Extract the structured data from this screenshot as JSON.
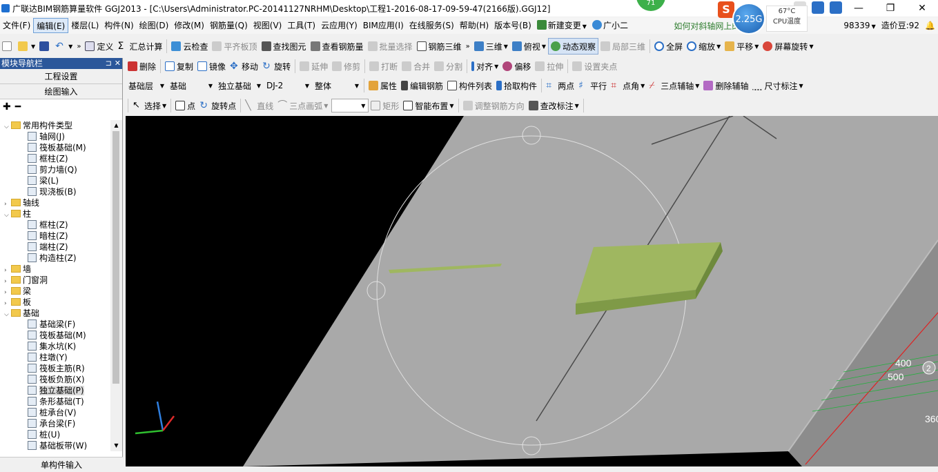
{
  "window": {
    "title": "广联达BIM钢筋算量软件 GGJ2013 - [C:\\Users\\Administrator.PC-20141127NRHM\\Desktop\\工程1-2016-08-17-09-59-47(2166版).GGJ12]",
    "minimize": "—",
    "maximize": "❐",
    "close": "✕"
  },
  "overlay": {
    "badge": "71",
    "memory": "2.25G",
    "cpu_temp": "67°C",
    "cpu_label": "CPU温度"
  },
  "menubar": {
    "items": [
      "文件(F)",
      "编辑(E)",
      "楼层(L)",
      "构件(N)",
      "绘图(D)",
      "修改(M)",
      "钢筋量(Q)",
      "视图(V)",
      "工具(T)",
      "云应用(Y)",
      "BIM应用(I)",
      "在线服务(S)",
      "帮助(H)",
      "版本号(B)"
    ],
    "new_change": "新建变更",
    "assistant": "广小二",
    "marquee": "如何对斜轴网上的",
    "account_id": "98339",
    "price_bean": "造价豆:92"
  },
  "toolbar1": {
    "define": "定义",
    "summary": "汇总计算",
    "cloud_check": "云检查",
    "flat_top": "平齐板顶",
    "find_element": "查找图元",
    "view_rebar": "查看钢筋量",
    "batch_select": "批量选择",
    "rebar_3d": "钢筋三维",
    "three_d": "三维",
    "top_view": "俯视",
    "dynamic_view": "动态观察",
    "local_3d": "局部三维",
    "fullscreen": "全屏",
    "zoom": "缩放",
    "pan": "平移",
    "screen_rotate": "屏幕旋转"
  },
  "toolbar2": {
    "delete": "删除",
    "copy": "复制",
    "mirror": "镜像",
    "move": "移动",
    "rotate": "旋转",
    "extend": "延伸",
    "trim": "修剪",
    "break": "打断",
    "merge": "合并",
    "split": "分割",
    "align": "对齐",
    "offset": "偏移",
    "stretch": "拉伸",
    "set_grip": "设置夹点"
  },
  "toolbar3": {
    "floor": "基础层",
    "category": "基础",
    "type": "独立基础",
    "element": "DJ-2",
    "part": "整体",
    "properties": "属性",
    "edit_rebar": "编辑钢筋",
    "element_list": "构件列表",
    "pick_element": "拾取构件",
    "two_point": "两点",
    "parallel": "平行",
    "point_angle": "点角",
    "three_point_axis": "三点辅轴",
    "delete_axis": "删除辅轴",
    "dimension": "尺寸标注"
  },
  "toolbar4": {
    "select": "选择",
    "point": "点",
    "rotate_point": "旋转点",
    "line": "直线",
    "arc": "三点画弧",
    "rect": "矩形",
    "smart_layout": "智能布置",
    "adjust_dir": "调整钢筋方向",
    "edit_label": "查改标注"
  },
  "sidebar": {
    "title": "模块导航栏",
    "pin": "⊐",
    "close": "✕",
    "project_settings": "工程设置",
    "drawing_input": "绘图输入",
    "single_input": "单构件输入",
    "tree": [
      {
        "level": 0,
        "type": "folder",
        "open": true,
        "label": "常用构件类型"
      },
      {
        "level": 1,
        "type": "item",
        "label": "轴网(J)"
      },
      {
        "level": 1,
        "type": "item",
        "label": "筏板基础(M)"
      },
      {
        "level": 1,
        "type": "item",
        "label": "框柱(Z)"
      },
      {
        "level": 1,
        "type": "item",
        "label": "剪力墙(Q)"
      },
      {
        "level": 1,
        "type": "item",
        "label": "梁(L)"
      },
      {
        "level": 1,
        "type": "item",
        "label": "现浇板(B)"
      },
      {
        "level": 0,
        "type": "folder",
        "open": false,
        "label": "轴线"
      },
      {
        "level": 0,
        "type": "folder",
        "open": true,
        "label": "柱"
      },
      {
        "level": 1,
        "type": "item",
        "label": "框柱(Z)"
      },
      {
        "level": 1,
        "type": "item",
        "label": "暗柱(Z)"
      },
      {
        "level": 1,
        "type": "item",
        "label": "端柱(Z)"
      },
      {
        "level": 1,
        "type": "item",
        "label": "构造柱(Z)"
      },
      {
        "level": 0,
        "type": "folder",
        "open": false,
        "label": "墙"
      },
      {
        "level": 0,
        "type": "folder",
        "open": false,
        "label": "门窗洞"
      },
      {
        "level": 0,
        "type": "folder",
        "open": false,
        "label": "梁"
      },
      {
        "level": 0,
        "type": "folder",
        "open": false,
        "label": "板"
      },
      {
        "level": 0,
        "type": "folder",
        "open": true,
        "label": "基础"
      },
      {
        "level": 1,
        "type": "item",
        "label": "基础梁(F)"
      },
      {
        "level": 1,
        "type": "item",
        "label": "筏板基础(M)"
      },
      {
        "level": 1,
        "type": "item",
        "label": "集水坑(K)"
      },
      {
        "level": 1,
        "type": "item",
        "label": "柱墩(Y)"
      },
      {
        "level": 1,
        "type": "item",
        "label": "筏板主筋(R)"
      },
      {
        "level": 1,
        "type": "item",
        "label": "筏板负筋(X)"
      },
      {
        "level": 1,
        "type": "item",
        "label": "独立基础(P)",
        "selected": true
      },
      {
        "level": 1,
        "type": "item",
        "label": "条形基础(T)"
      },
      {
        "level": 1,
        "type": "item",
        "label": "桩承台(V)"
      },
      {
        "level": 1,
        "type": "item",
        "label": "承台梁(F)"
      },
      {
        "level": 1,
        "type": "item",
        "label": "桩(U)"
      },
      {
        "level": 1,
        "type": "item",
        "label": "基础板带(W)"
      }
    ]
  },
  "viewport": {
    "dim_labels": [
      "400",
      "500",
      "360"
    ],
    "axis_badge": "2"
  },
  "colors": {
    "slab": "#a9a9a9",
    "footing": "#9fb760",
    "accent": "#2b579a"
  }
}
